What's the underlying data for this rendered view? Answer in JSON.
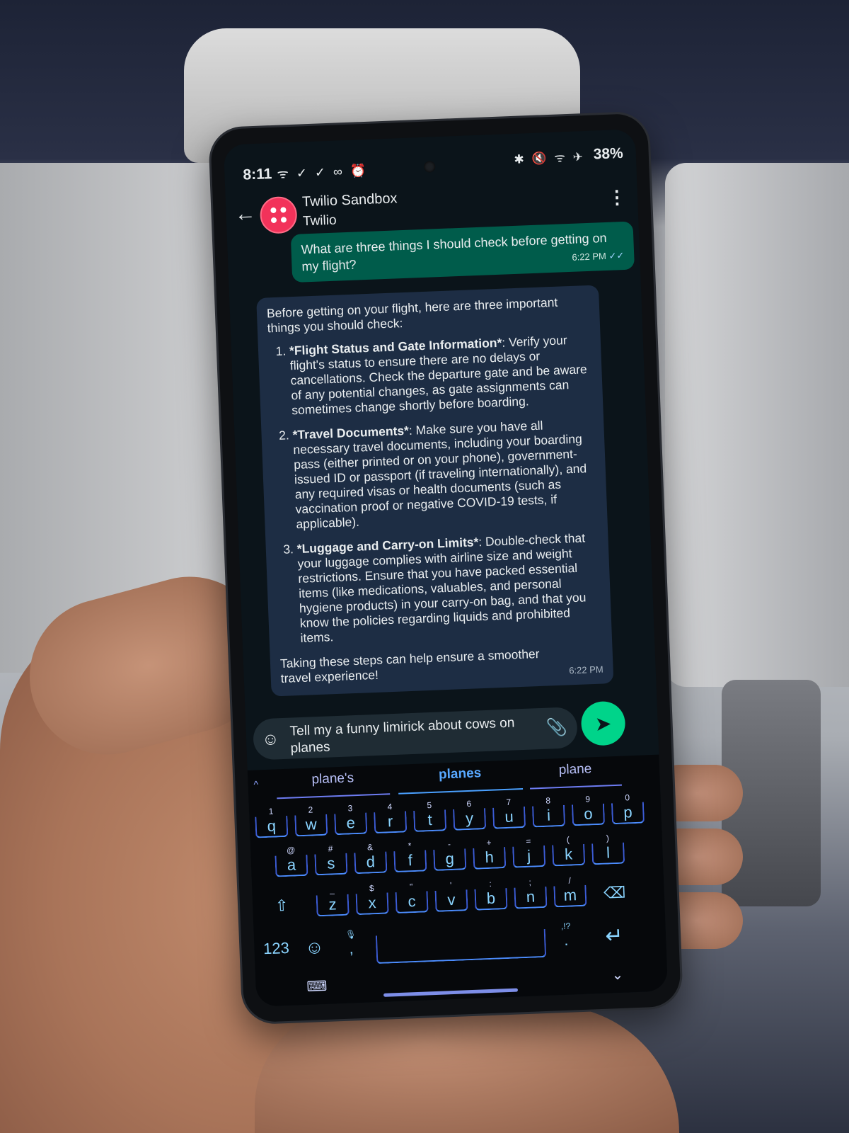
{
  "status_bar": {
    "time": "8:11",
    "left_icons": "ᯤ ✓ ✓ ∞ ⏰",
    "right_icons": "✱ 🔇 ᯤ ✈",
    "battery": "38%"
  },
  "header": {
    "contact_name": "Twilio Sandbox",
    "contact_subtitle": "Twilio"
  },
  "messages": {
    "outgoing": {
      "text": "What are three things I should check before getting on my flight?",
      "time": "6:22 PM",
      "ticks": "✓✓"
    },
    "incoming": {
      "intro": "Before getting on your flight, here are three important things you should check:",
      "items": [
        {
          "title": "*Flight Status and Gate Information*",
          "body": ": Verify your flight's status to ensure there are no delays or cancellations. Check the departure gate and be aware of any potential changes, as gate assignments can sometimes change shortly before boarding."
        },
        {
          "title": "*Travel Documents*",
          "body": ": Make sure you have all necessary travel documents, including your boarding pass (either printed or on your phone), government-issued ID or passport (if traveling internationally), and any required visas or health documents (such as vaccination proof or negative COVID-19 tests, if applicable)."
        },
        {
          "title": "*Luggage and Carry-on Limits*",
          "body": ": Double-check that your luggage complies with airline size and weight restrictions. Ensure that you have packed essential items (like medications, valuables, and personal hygiene products) in your carry-on bag, and that you know the policies regarding liquids and prohibited items."
        }
      ],
      "outro": "Taking these steps can help ensure a smoother travel experience!",
      "time": "6:22 PM"
    }
  },
  "composer": {
    "value": "Tell my a funny limirick about cows on planes"
  },
  "keyboard": {
    "suggestions": [
      "plane's",
      "planes",
      "plane"
    ],
    "row1": [
      {
        "hint": "1",
        "key": "q"
      },
      {
        "hint": "2",
        "key": "w"
      },
      {
        "hint": "3",
        "key": "e"
      },
      {
        "hint": "4",
        "key": "r"
      },
      {
        "hint": "5",
        "key": "t"
      },
      {
        "hint": "6",
        "key": "y"
      },
      {
        "hint": "7",
        "key": "u"
      },
      {
        "hint": "8",
        "key": "i"
      },
      {
        "hint": "9",
        "key": "o"
      },
      {
        "hint": "0",
        "key": "p"
      }
    ],
    "row2": [
      {
        "hint": "@",
        "key": "a"
      },
      {
        "hint": "#",
        "key": "s"
      },
      {
        "hint": "&",
        "key": "d"
      },
      {
        "hint": "*",
        "key": "f"
      },
      {
        "hint": "-",
        "key": "g"
      },
      {
        "hint": "+",
        "key": "h"
      },
      {
        "hint": "=",
        "key": "j"
      },
      {
        "hint": "(",
        "key": "k"
      },
      {
        "hint": ")",
        "key": "l"
      }
    ],
    "row3": [
      {
        "hint": "_",
        "key": "z"
      },
      {
        "hint": "$",
        "key": "x"
      },
      {
        "hint": "\"",
        "key": "c"
      },
      {
        "hint": "'",
        "key": "v"
      },
      {
        "hint": ":",
        "key": "b"
      },
      {
        "hint": ";",
        "key": "n"
      },
      {
        "hint": "/",
        "key": "m"
      }
    ],
    "numbers_label": "123",
    "comma": ",",
    "period": ".",
    "period_hint": ",!?",
    "shift": "⇧",
    "backspace": "⌫",
    "enter": "↵",
    "emoji": "☺",
    "mic": "🎙"
  }
}
